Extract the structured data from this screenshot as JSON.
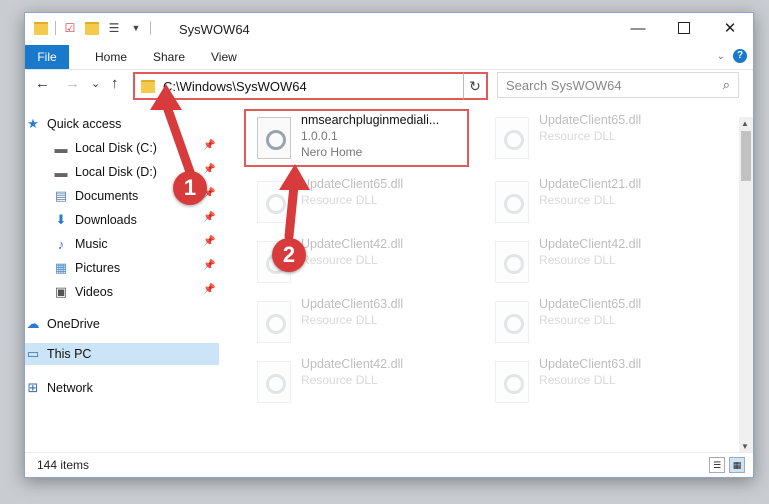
{
  "window": {
    "title": "SysWOW64",
    "controls": {
      "minimize": "—",
      "maximize": "☐",
      "close": "✕"
    }
  },
  "ribbon": {
    "tabs": [
      "File",
      "Home",
      "Share",
      "View"
    ],
    "help": "?"
  },
  "navbar": {
    "back": "←",
    "forward": "→",
    "recent": "⌄",
    "up": "↑",
    "address": "C:\\Windows\\SysWOW64",
    "refresh": "↻",
    "search_placeholder": "Search SysWOW64"
  },
  "sidebar": {
    "items": [
      {
        "label": "Quick access",
        "icon": "star-icon"
      },
      {
        "label": "Local Disk (C:)",
        "icon": "drive-icon",
        "pinned": true
      },
      {
        "label": "Local Disk (D:)",
        "icon": "drive-icon",
        "pinned": true
      },
      {
        "label": "Documents",
        "icon": "documents-icon",
        "pinned": true
      },
      {
        "label": "Downloads",
        "icon": "downloads-icon",
        "pinned": true
      },
      {
        "label": "Music",
        "icon": "music-icon",
        "pinned": true
      },
      {
        "label": "Pictures",
        "icon": "pictures-icon",
        "pinned": true
      },
      {
        "label": "Videos",
        "icon": "videos-icon",
        "pinned": true
      },
      {
        "label": "OneDrive",
        "icon": "cloud-icon"
      },
      {
        "label": "This PC",
        "icon": "computer-icon",
        "selected": true
      },
      {
        "label": "Network",
        "icon": "network-icon"
      }
    ]
  },
  "files": [
    {
      "name": "nmsearchpluginmediali...",
      "line2": "1.0.0.1",
      "line3": "Nero Home",
      "highlighted": true
    },
    {
      "name": "UpdateClient65.dll",
      "line2": "Resource DLL"
    },
    {
      "name": "UpdateClient65.dll",
      "line2": "Resource DLL"
    },
    {
      "name": "UpdateClient21.dll",
      "line2": "Resource DLL"
    },
    {
      "name": "UpdateClient42.dll",
      "line2": "Resource DLL"
    },
    {
      "name": "UpdateClient42.dll",
      "line2": "Resource DLL"
    },
    {
      "name": "UpdateClient63.dll",
      "line2": "Resource DLL"
    },
    {
      "name": "UpdateClient65.dll",
      "line2": "Resource DLL"
    },
    {
      "name": "UpdateClient42.dll",
      "line2": "Resource DLL"
    },
    {
      "name": "UpdateClient63.dll",
      "line2": "Resource DLL"
    }
  ],
  "status": {
    "count": "144 items"
  },
  "annotations": {
    "step1": "1",
    "step2": "2"
  },
  "colors": {
    "accent": "#1979ca",
    "highlight": "#e05a5a",
    "selection": "#cce4f7"
  }
}
